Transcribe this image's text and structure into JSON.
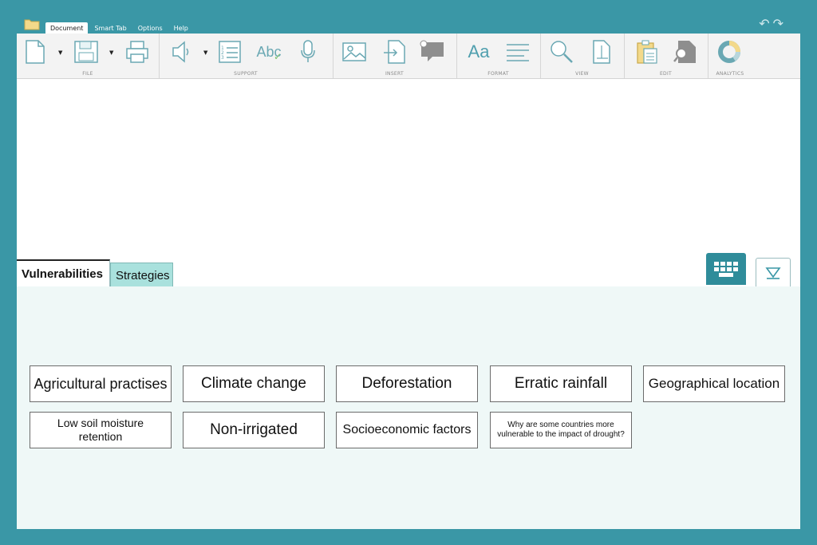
{
  "menu": {
    "tabs": [
      {
        "label": "Document",
        "active": true
      },
      {
        "label": "Smart Tab",
        "active": false
      },
      {
        "label": "Options",
        "active": false
      },
      {
        "label": "Help",
        "active": false
      }
    ]
  },
  "ribbon": {
    "groups": {
      "file": "FILE",
      "support": "SUPPORT",
      "insert": "INSERT",
      "format": "FORMAT",
      "view": "VIEW",
      "edit": "EDIT",
      "analytics": "ANALYTICS"
    },
    "spell_icon_text": "Abc",
    "font_icon_text": "Aa"
  },
  "tabs": {
    "vulnerabilities": "Vulnerabilities",
    "strategies": "Strategies"
  },
  "cards": [
    "Agricultural practises",
    "Climate change",
    "Deforestation",
    "Erratic rainfall",
    "Geographical location",
    "Low soil moisture retention",
    "Non-irrigated",
    "Socioeconomic factors",
    "Why are some countries more vulnerable to the impact of drought?"
  ],
  "colors": {
    "frame": "#3a97a6",
    "accent": "#2f8c9a",
    "tab_inactive": "#a9e1dd",
    "panel": "#eff8f7"
  }
}
